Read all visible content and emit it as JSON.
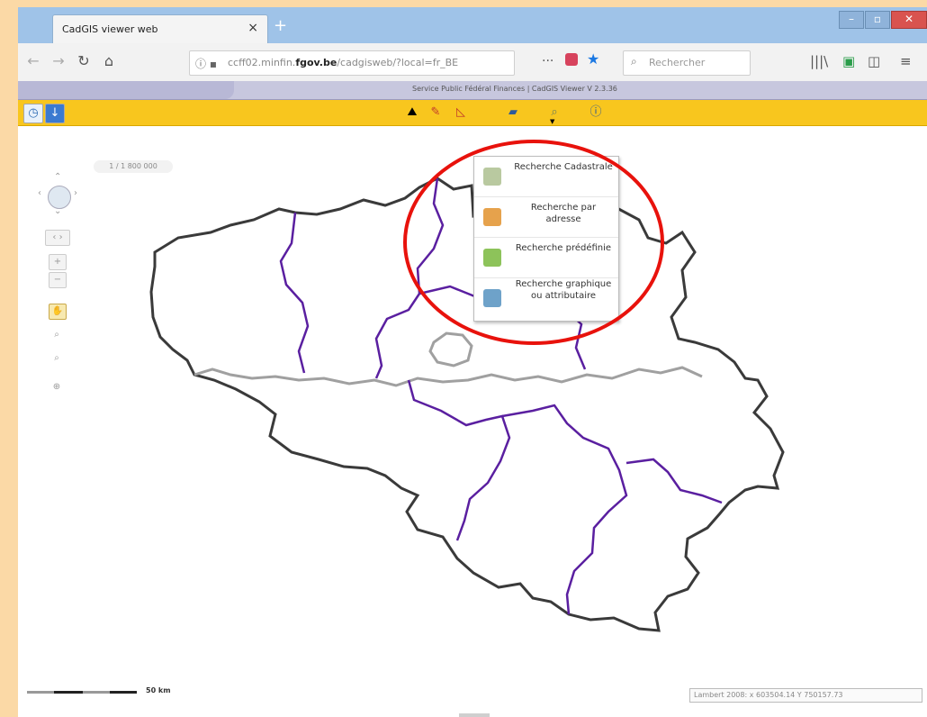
{
  "browser": {
    "tab_title": "CadGIS viewer web",
    "tab_close": "×",
    "new_tab": "+",
    "url_host_prefix": "ccff02.minfin.",
    "url_host_domain": "fgov.be",
    "url_path": "/cadgisweb/?local=fr_BE",
    "url_more": "···",
    "search_placeholder": "Rechercher",
    "icons": [
      "back-arrow",
      "forward-arrow",
      "reload",
      "home",
      "info",
      "lock",
      "pocket",
      "bookmark-star",
      "library",
      "reader",
      "sidebar",
      "menu"
    ]
  },
  "app": {
    "header_text": "Service Public Fédéral Finances  |  CadGIS Viewer V 2.3.36"
  },
  "map": {
    "scale_ratio": "1 / 1 800 000",
    "scale_label": "50 km",
    "coordinates": "Lambert 2008:  x 603504.14  Y 750157.73"
  },
  "search_menu": {
    "items": [
      {
        "label": "Recherche Cadastrale",
        "icon": "cadastral-search-icon",
        "color": "#b9c9a0"
      },
      {
        "label": "Recherche par adresse",
        "icon": "address-search-icon",
        "color": "#e6a24c"
      },
      {
        "label": "Recherche prédéfinie",
        "icon": "predefined-search-icon",
        "color": "#8dc35a"
      },
      {
        "label": "Recherche graphique ou attributaire",
        "icon": "graphic-search-icon",
        "color": "#6ea2c9"
      }
    ]
  },
  "colors": {
    "toolbar": "#f8c61e",
    "highlight_ring": "#e8120c",
    "region_border": "#3a3a3a",
    "province_border": "#5a1fa0",
    "language_border": "#a0a0a0"
  }
}
